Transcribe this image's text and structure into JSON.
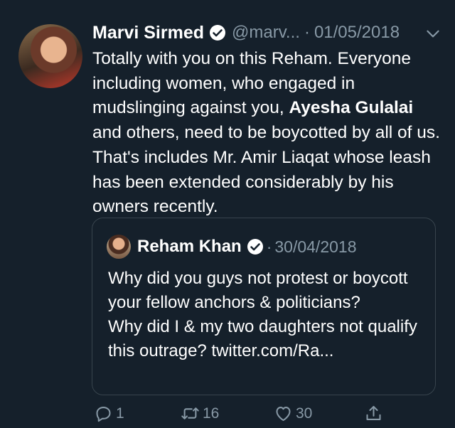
{
  "tweet": {
    "author_name": "Marvi Sirmed",
    "handle": "@marv...",
    "separator": "·",
    "date": "01/05/2018",
    "text_part1": "Totally with you on this Reham. Everyone including women, who engaged in mudslinging against you, ",
    "text_bold": "Ayesha Gulalai",
    "text_part2": " and others, need to be boycotted by all of us. That's includes Mr. Amir Liaqat whose leash has been extended considerably by his owners recently."
  },
  "quoted": {
    "author_name": "Reham Khan",
    "separator": "·",
    "date": "30/04/2018",
    "line1": "Why did you guys not protest or boycott your fellow anchors & politicians?",
    "line2": "Why did I & my two daughters not qualify this outrage? twitter.com/Ra..."
  },
  "actions": {
    "reply_count": "1",
    "retweet_count": "16",
    "like_count": "30"
  },
  "colors": {
    "background": "#15202b",
    "muted": "#8899a6",
    "border": "#38444d"
  }
}
